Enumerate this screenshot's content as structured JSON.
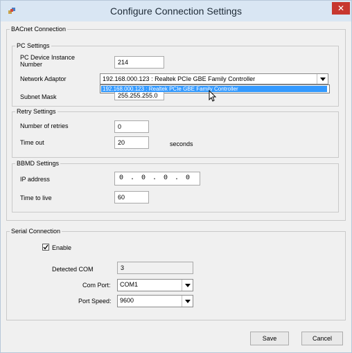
{
  "window": {
    "title": "Configure Connection Settings",
    "close_glyph": "✕"
  },
  "bacnet": {
    "legend": "BACnet Connection",
    "pc_settings": {
      "legend": "PC Settings",
      "device_instance_label": "PC Device Instance Number",
      "device_instance_value": "214",
      "network_adaptor_label": "Network Adaptor",
      "network_adaptor_value": "192.168.000.123 : Realtek PCIe GBE Family Controller",
      "dropdown_option": "192.168.000.123 : Realtek PCIe GBE Family Controller",
      "subnet_mask_label": "Subnet Mask",
      "subnet_mask_value": "255.255.255.0"
    },
    "retry_settings": {
      "legend": "Retry Settings",
      "retries_label": "Number of retries",
      "retries_value": "0",
      "timeout_label": "Time out",
      "timeout_value": "20",
      "timeout_unit": "seconds"
    },
    "bbmd_settings": {
      "legend": "BBMD Settings",
      "ip_label": "IP address",
      "ip_value": "0 . 0 . 0 . 0",
      "ttl_label": "Time to live",
      "ttl_value": "60"
    }
  },
  "serial": {
    "legend": "Serial Connection",
    "enable_label": "Enable",
    "enable_checked": true,
    "detected_com_label": "Detected COM",
    "detected_com_value": "3",
    "com_port_label": "Com Port:",
    "com_port_value": "COM1",
    "port_speed_label": "Port Speed:",
    "port_speed_value": "9600"
  },
  "buttons": {
    "save": "Save",
    "cancel": "Cancel"
  },
  "icons": {
    "app": "network-icon",
    "close": "close-icon",
    "dropdown": "chevron-down-icon",
    "cursor": "mouse-pointer-icon"
  },
  "colors": {
    "titlebar": "#d9e6f3",
    "close": "#c7372f",
    "selection": "#3399ff"
  }
}
